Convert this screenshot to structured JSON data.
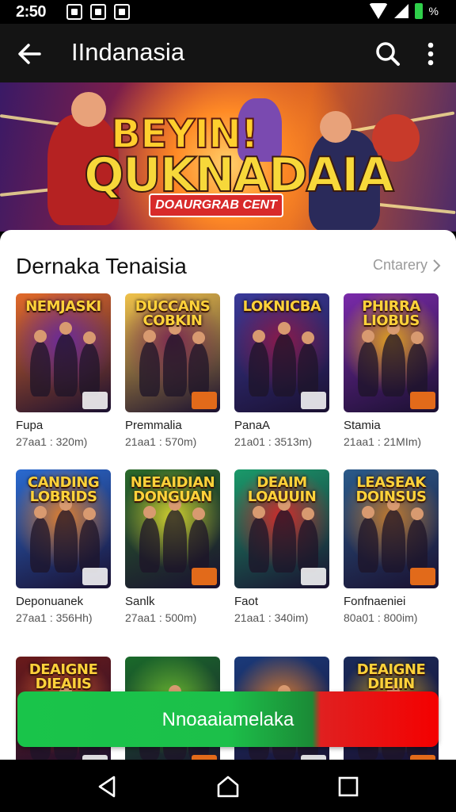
{
  "status_bar": {
    "time": "2:50",
    "battery_pct": "%"
  },
  "toolbar": {
    "title": "IIndanasia"
  },
  "banner": {
    "title_line1": "BEYIN!",
    "title_line2": "QUKNADAIA",
    "ribbon": "DOAURGRAB CENT"
  },
  "section": {
    "title": "Dernaka Tenaisia",
    "link": "Cntarery"
  },
  "cards": [
    {
      "art": "NEMJASKI",
      "name": "Fupa",
      "sub": "27aa1 : 320m)",
      "palette": [
        "#e26a2a",
        "#6a2a9a"
      ]
    },
    {
      "art": "DUCCANS COBKIN",
      "name": "Premmalia",
      "sub": "21aa1 : 570m)",
      "palette": [
        "#f0c24a",
        "#7a2a50"
      ]
    },
    {
      "art": "LOKNICBA",
      "name": "PanaA",
      "sub": "21a01 : 3513m)",
      "palette": [
        "#3a3a9a",
        "#8a1a4a"
      ]
    },
    {
      "art": "PHIRRA LIOBUS",
      "name": "Stamia",
      "sub": "21aa1 : 21MIm)",
      "palette": [
        "#7a2aaa",
        "#e0a020"
      ]
    },
    {
      "art": "CANDING LOBRIDS",
      "name": "Deponuanek",
      "sub": "27aa1 : 356Hh)",
      "palette": [
        "#2a6ad0",
        "#e08030"
      ]
    },
    {
      "art": "NEEAIDIAN DONGUAN",
      "name": "Sanlk",
      "sub": "27aa1 : 500m)",
      "palette": [
        "#2a6a2a",
        "#d0d030"
      ]
    },
    {
      "art": "DEAIM LOAUUIN",
      "name": "Faot",
      "sub": "21aa1 : 340im)",
      "palette": [
        "#1a9a6a",
        "#d02a2a"
      ]
    },
    {
      "art": "LEASEAK DOINSUS",
      "name": "Fonfnaeniei",
      "sub": "80a01 : 800im)",
      "palette": [
        "#2a5a8a",
        "#c07a30"
      ]
    },
    {
      "art": "DEAIGNE DIEAIIS",
      "name": "",
      "sub": "",
      "palette": [
        "#6a1a1a",
        "#e06030"
      ]
    },
    {
      "art": "",
      "name": "",
      "sub": "",
      "palette": [
        "#1a6a2a",
        "#70c030"
      ]
    },
    {
      "art": "",
      "name": "",
      "sub": "",
      "palette": [
        "#1a3a7a",
        "#e08030"
      ]
    },
    {
      "art": "DEAIGNE DIEIIN",
      "name": "",
      "sub": "",
      "palette": [
        "#1a2a5a",
        "#d0a020"
      ]
    }
  ],
  "cta": {
    "label": "Nnoaaiamelaka"
  }
}
